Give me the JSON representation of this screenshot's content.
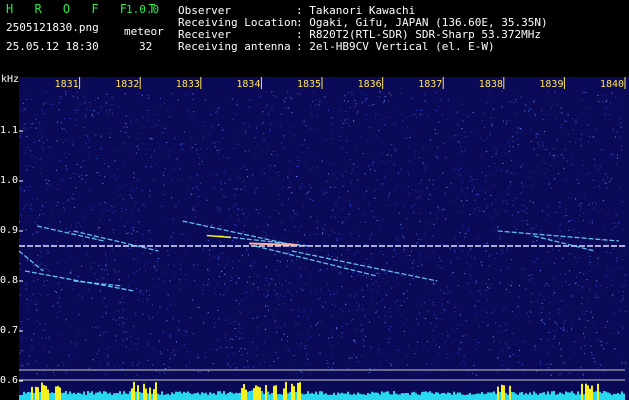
{
  "app": {
    "name": "H R O F F T",
    "version": "1.0.0"
  },
  "file": {
    "name": "2505121830.png",
    "datetime": "25.05.12 18:30"
  },
  "meteor": {
    "label": "meteor",
    "count": "32"
  },
  "info": [
    {
      "key": "Observer",
      "value": ": Takanori Kawachi"
    },
    {
      "key": "Receiving Location",
      "value": ": Ogaki, Gifu, JAPAN (136.60E, 35.35N)"
    },
    {
      "key": "Receiver",
      "value": ": R820T2(RTL-SDR) SDR-Sharp 53.372MHz"
    },
    {
      "key": "Receiving antenna",
      "value": ": 2el-HB9CV Vertical (el. E-W)"
    }
  ],
  "chart_data": {
    "type": "spectrogram",
    "ylabel": "kHz",
    "x_ticks": [
      "1831",
      "1832",
      "1833",
      "1834",
      "1835",
      "1836",
      "1837",
      "1838",
      "1839",
      "1840"
    ],
    "y_ticks": [
      "1.1",
      "1.0",
      "0.9",
      "0.8",
      "0.7",
      "0.6"
    ],
    "y_range": [
      0.58,
      1.2
    ],
    "carrier_khz": 0.87,
    "colors": {
      "background": "#0a0a58",
      "carrier": "#e0e0ff",
      "level": "#28d8f0",
      "level_peak": "#f4f020"
    },
    "traces": [
      {
        "x": [
          1830.3,
          1831.4
        ],
        "y": [
          0.91,
          0.88
        ]
      },
      {
        "x": [
          1830.9,
          1832.3
        ],
        "y": [
          0.9,
          0.86
        ]
      },
      {
        "x": [
          1832.7,
          1834.6
        ],
        "y": [
          0.92,
          0.87
        ]
      },
      {
        "x": [
          1833.3,
          1834.8
        ],
        "y": [
          0.89,
          0.87
        ]
      },
      {
        "x": [
          1833.9,
          1835.9
        ],
        "y": [
          0.87,
          0.81
        ]
      },
      {
        "x": [
          1834.5,
          1836.9
        ],
        "y": [
          0.86,
          0.8
        ]
      },
      {
        "x": [
          1830.1,
          1831.9
        ],
        "y": [
          0.82,
          0.78
        ]
      },
      {
        "x": [
          1830.9,
          1831.7
        ],
        "y": [
          0.8,
          0.79
        ]
      },
      {
        "x": [
          1837.9,
          1839.9
        ],
        "y": [
          0.9,
          0.88
        ]
      },
      {
        "x": [
          1838.5,
          1839.5
        ],
        "y": [
          0.89,
          0.86
        ]
      },
      {
        "x": [
          1830.0,
          1830.4
        ],
        "y": [
          0.86,
          0.82
        ]
      }
    ]
  }
}
